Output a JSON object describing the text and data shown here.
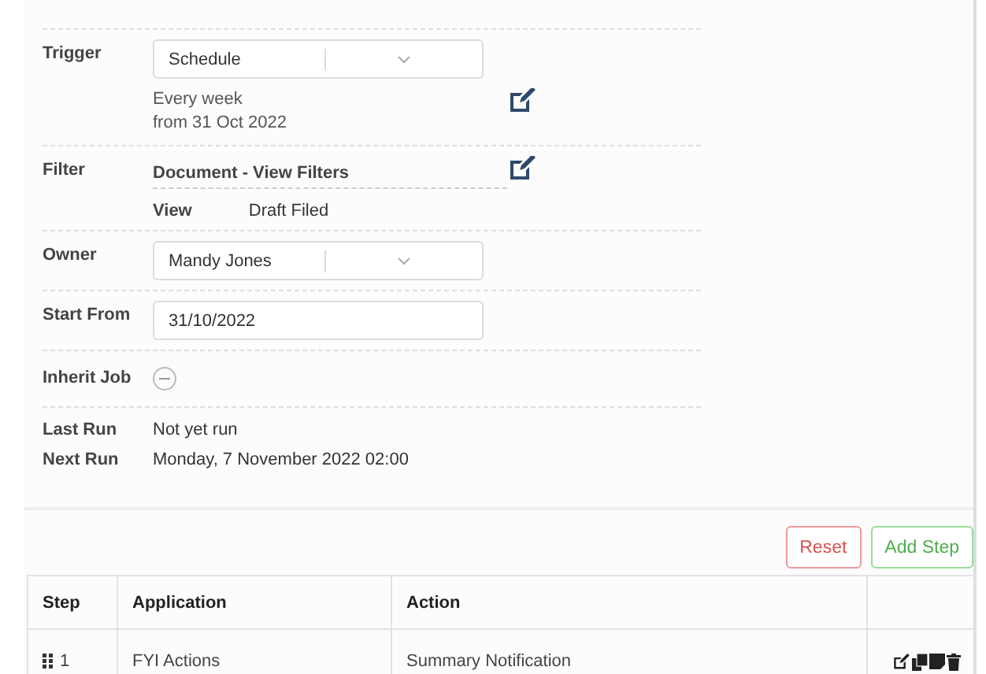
{
  "form": {
    "trigger": {
      "label": "Trigger",
      "value": "Schedule",
      "summary": [
        "Every week",
        "from 31 Oct 2022"
      ]
    },
    "filter": {
      "label": "Filter",
      "title": "Document - View Filters",
      "key": "View",
      "value": "Draft Filed"
    },
    "owner": {
      "label": "Owner",
      "value": "Mandy Jones"
    },
    "start_from": {
      "label": "Start From",
      "value": "31/10/2022"
    },
    "inherit_job": {
      "label": "Inherit Job",
      "on": false
    },
    "runs": [
      {
        "label": "Last Run",
        "value": "Not yet run"
      },
      {
        "label": "Next Run",
        "value": "Monday, 7 November 2022 02:00"
      }
    ]
  },
  "buttons": [
    {
      "label": "Reset",
      "kind": "danger"
    },
    {
      "label": "Add Step",
      "kind": "success"
    }
  ],
  "table": {
    "columns": [
      "Step",
      "Application",
      "Action"
    ],
    "rows": [
      {
        "step": "1",
        "application": "FYI Actions",
        "action": "Summary Notification"
      }
    ]
  }
}
